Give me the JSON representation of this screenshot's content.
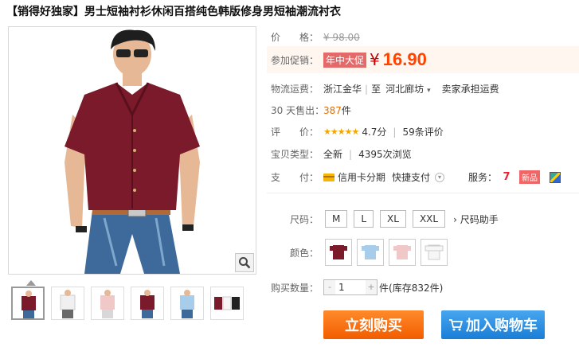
{
  "product": {
    "title": "【销得好独家】男士短袖衬衫休闲百搭纯色韩版修身男短袖潮流衬衣"
  },
  "price": {
    "label": "价　　格：",
    "original": "¥ 98.00"
  },
  "promo": {
    "label": "参加促销：",
    "tag": "年中大促",
    "yen": "¥",
    "price": "16.90"
  },
  "shipping": {
    "label": "物流运费：",
    "from": "浙江金华",
    "to_label": "至",
    "to": "河北廊坊",
    "note": "卖家承担运费"
  },
  "sales": {
    "label": "30 天售出：",
    "count": "387",
    "unit": "件"
  },
  "rating": {
    "label": "评　　价：",
    "stars": "★★★★★",
    "score": "4.7分",
    "reviews": "59条评价"
  },
  "type": {
    "label": "宝贝类型：",
    "value": "全新",
    "views": "4395次浏览"
  },
  "payment": {
    "label": "支　　付：",
    "credit": "信用卡分期",
    "quick": "快捷支付",
    "service_label": "服务：",
    "service_7": "7",
    "new_badge": "新品"
  },
  "size": {
    "label": "尺码：",
    "options": [
      "M",
      "L",
      "XL",
      "XXL"
    ],
    "helper": "尺码助手"
  },
  "color": {
    "label": "颜色：",
    "swatches": [
      "#7a1a2a",
      "#a8cdea",
      "#f0c8c8",
      "#f6f6f6"
    ]
  },
  "quantity": {
    "label": "购买数量：",
    "minus": "-",
    "value": "1",
    "plus": "+",
    "unit": "件",
    "stock": "(库存832件)"
  },
  "buttons": {
    "buy": "立刻购买",
    "cart": "加入购物车"
  },
  "thumbs": {
    "colors": [
      "#7a1a2a",
      "#f6f6f6",
      "#f0c8c8",
      "#7a1a2a",
      "#a8cdea",
      "#222222"
    ]
  }
}
